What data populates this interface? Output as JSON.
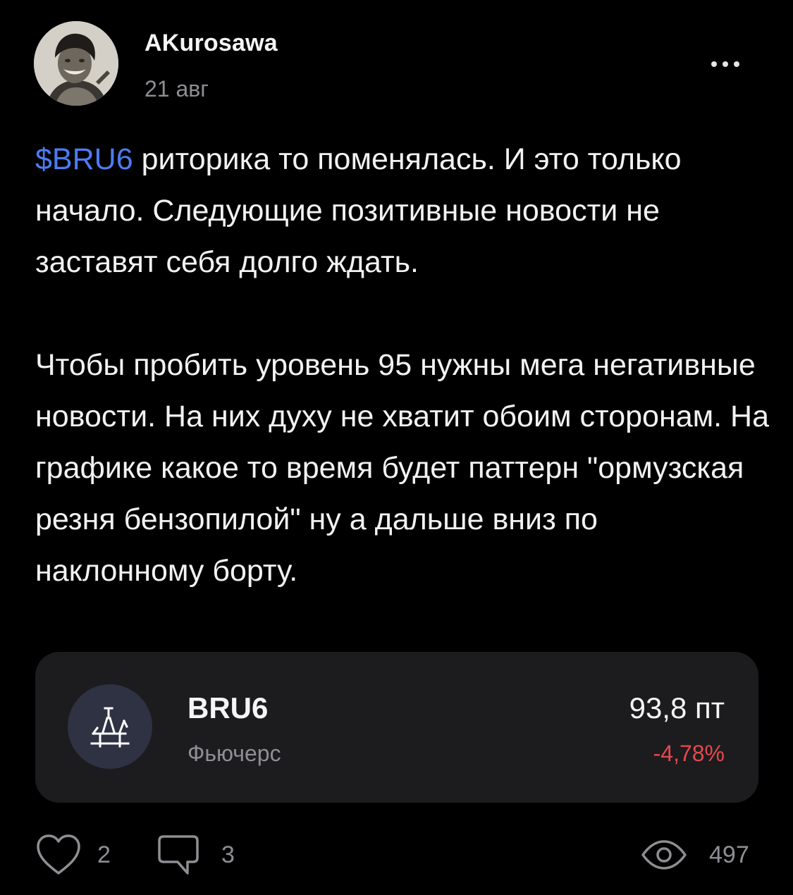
{
  "post": {
    "author": "AKurosawa",
    "date": "21 авг",
    "more_icon": "more-dots-icon",
    "ticker_link": "$BRU6",
    "paragraph1_rest": " риторика то поменялась. И это только начало. Следующие позитивные новости не заставят себя долго ждать.",
    "paragraph2": "Чтобы пробить уровень 95 нужны мега негативные новости. На них духу не хватит обоим сторонам. На графике какое то время будет паттерн \"ормузская резня бензопилой\" ну а дальше вниз по наклонному борту."
  },
  "instrument_card": {
    "icon": "oil-platform-icon",
    "ticker": "BRU6",
    "type": "Фьючерс",
    "price": "93,8 пт",
    "change": "-4,78%",
    "change_color": "#e5484d",
    "icon_bg": "#2e3243"
  },
  "footer": {
    "likes_icon": "heart-icon",
    "likes": "2",
    "comments_icon": "comment-icon",
    "comments": "3",
    "views_icon": "eye-icon",
    "views": "497"
  },
  "colors": {
    "background": "#000000",
    "link": "#4c7cf3",
    "muted": "#8e8e93",
    "card": "#1c1c1e"
  }
}
